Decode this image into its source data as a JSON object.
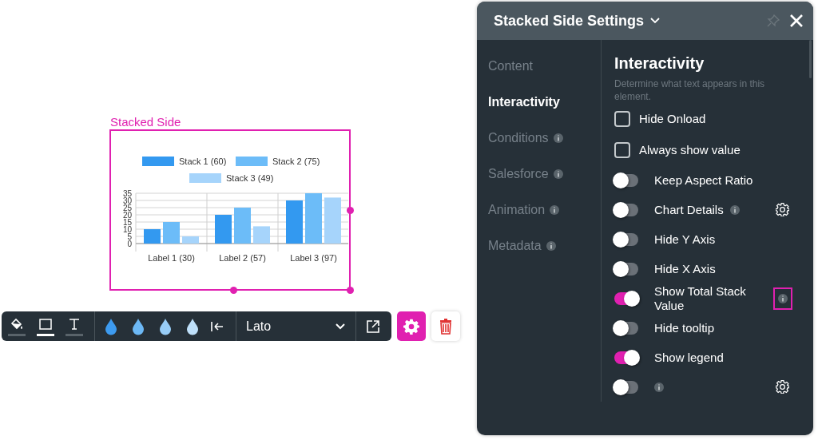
{
  "canvas": {
    "element_label": "Stacked Side",
    "chart_data": {
      "type": "bar",
      "categories": [
        "Label 1 (30)",
        "Label 2 (57)",
        "Label 3 (97)"
      ],
      "series": [
        {
          "name": "Stack 1 (60)",
          "color": "#3399f0",
          "values": [
            10,
            20,
            30
          ]
        },
        {
          "name": "Stack 2 (75)",
          "color": "#6cbcf8",
          "values": [
            15,
            25,
            35
          ]
        },
        {
          "name": "Stack 3 (49)",
          "color": "#a6d4fb",
          "values": [
            5,
            12,
            32
          ]
        }
      ],
      "ylim": [
        0,
        35
      ],
      "grid": true,
      "legend": true,
      "yticks": [
        0,
        5,
        10,
        15,
        20,
        25,
        30,
        35
      ]
    }
  },
  "toolbar": {
    "tools": [
      {
        "kind": "fill",
        "selected": false
      },
      {
        "kind": "border",
        "selected": true
      },
      {
        "kind": "text",
        "selected": false
      }
    ],
    "swatches": [
      {
        "color": "#3d9bf0"
      },
      {
        "color": "#6cb8f5"
      },
      {
        "color": "#98cdf7"
      },
      {
        "color": "#bfe0fa"
      }
    ],
    "font": "Lato"
  },
  "panel": {
    "title": "Stacked Side Settings",
    "nav": [
      {
        "label": "Content",
        "selected": false,
        "info": false
      },
      {
        "label": "Interactivity",
        "selected": true,
        "info": false
      },
      {
        "label": "Conditions",
        "selected": false,
        "info": true
      },
      {
        "label": "Salesforce",
        "selected": false,
        "info": true
      },
      {
        "label": "Animation",
        "selected": false,
        "info": true
      },
      {
        "label": "Metadata",
        "selected": false,
        "info": true
      }
    ],
    "section_title": "Interactivity",
    "description": "Determine what text appears in this element.",
    "options": [
      {
        "kind": "checkbox",
        "label": "Hide Onload",
        "checked": false
      },
      {
        "kind": "checkbox",
        "label": "Always show value",
        "checked": false
      },
      {
        "kind": "toggle",
        "label": "Keep Aspect Ratio",
        "on": false
      },
      {
        "kind": "toggle",
        "label": "Chart Details",
        "on": false,
        "info": true,
        "gear": true
      },
      {
        "kind": "toggle",
        "label": "Hide Y Axis",
        "on": false
      },
      {
        "kind": "toggle",
        "label": "Hide X Axis",
        "on": false
      },
      {
        "kind": "toggle",
        "label": "Show Total Stack Value",
        "on": true,
        "info_button": true,
        "highlighted": true
      },
      {
        "kind": "toggle",
        "label": "Hide tooltip",
        "on": false
      },
      {
        "kind": "toggle",
        "label": "Show legend",
        "on": true
      },
      {
        "kind": "toggle",
        "on": false,
        "info": true,
        "gear": true
      }
    ]
  }
}
